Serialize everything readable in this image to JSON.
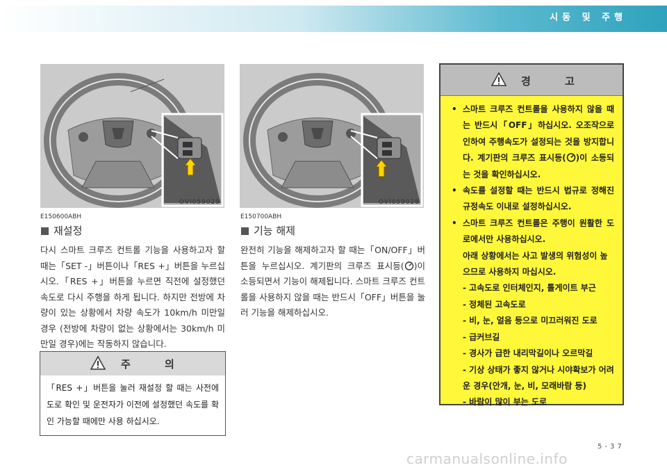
{
  "header": {
    "chapter_title": "시동 및 주행"
  },
  "left": {
    "figure_code": "OVI059029",
    "section_code": "E150600ABH",
    "section_title": "재설정",
    "body": "다시 스마트 크루즈 컨트롤 기능을 사용하고자 할 때는「SET -」버튼이나「RES +」버튼을 누르십시오.「RES +」버튼을 누르면 직전에 설정했던 속도로 다시 주행을 하게 됩니다. 하지만 전방에 차량이 있는 상황에서 차량 속도가 10km/h 미만일 경우 (전방에 차량이 없는 상황에서는 30km/h 미만일 경우)에는 작동하지 않습니다.",
    "caution": {
      "label": "주 의",
      "text": "「RES +」버튼을 눌러 재설정 할 때는 사전에 도로 확인 및 운전자가 이전에 설정했던 속도를 확인 가능할 때에만 사용 하십시오."
    }
  },
  "middle": {
    "figure_code": "OVI059028",
    "section_code": "E150700ABH",
    "section_title": "기능 해제",
    "body_before_icon": "완전히 기능을 해제하고자 할 때는「ON/OFF」버튼을 누르십시오. 계기판의 크루즈 표시등(",
    "body_after_icon": ")이 소등되면서 기능이 해제됩니다. 스마트 크루즈 컨트롤을 사용하지 않을 때는 반드시「OFF」버튼을 눌러 기능을 해제하십시오."
  },
  "warning": {
    "label": "경 고",
    "items": [
      {
        "before_icon": "스마트 크루즈 컨트롤을 사용하지 않을 때는 반드시「OFF」하십시오. 오조작으로 인하여 주행속도가 설정되는 것을 방지합니다. 계기판의 크루즈 표시등(",
        "after_icon": ")이 소등되는 것을 확인하십시오."
      },
      {
        "text": "속도를 설정할 때는 반드시 법규로 정해진 규정속도 이내로 설정하십시오."
      },
      {
        "text": "스마트 크루즈 컨트롤은 주행이 원활한 도로에서만 사용하십시오."
      }
    ],
    "sub_intro": "아래 상황에서는 사고 발생의 위험성이 높으므로 사용하지 마십시오.",
    "sub_items": [
      "- 고속도로 인터체인지, 톨게이트 부근",
      "- 정체된 고속도로",
      "- 비, 눈, 얼음 등으로 미끄러워진 도로",
      "- 급커브길",
      "- 경사가 급한 내리막길이나 오르막길",
      "- 기상 상태가 좋지 않거나 시야확보가 어려운 경우(안개, 눈, 비, 모래바람 등)",
      "- 바람이 많이 부는 도로"
    ]
  },
  "footer": {
    "page_number": "5-37",
    "watermark": "carmanualsonline.info"
  },
  "colors": {
    "header_band": "#5cbad0",
    "warning_bg": "#fff83a",
    "caution_head": "#d9d9d9"
  }
}
